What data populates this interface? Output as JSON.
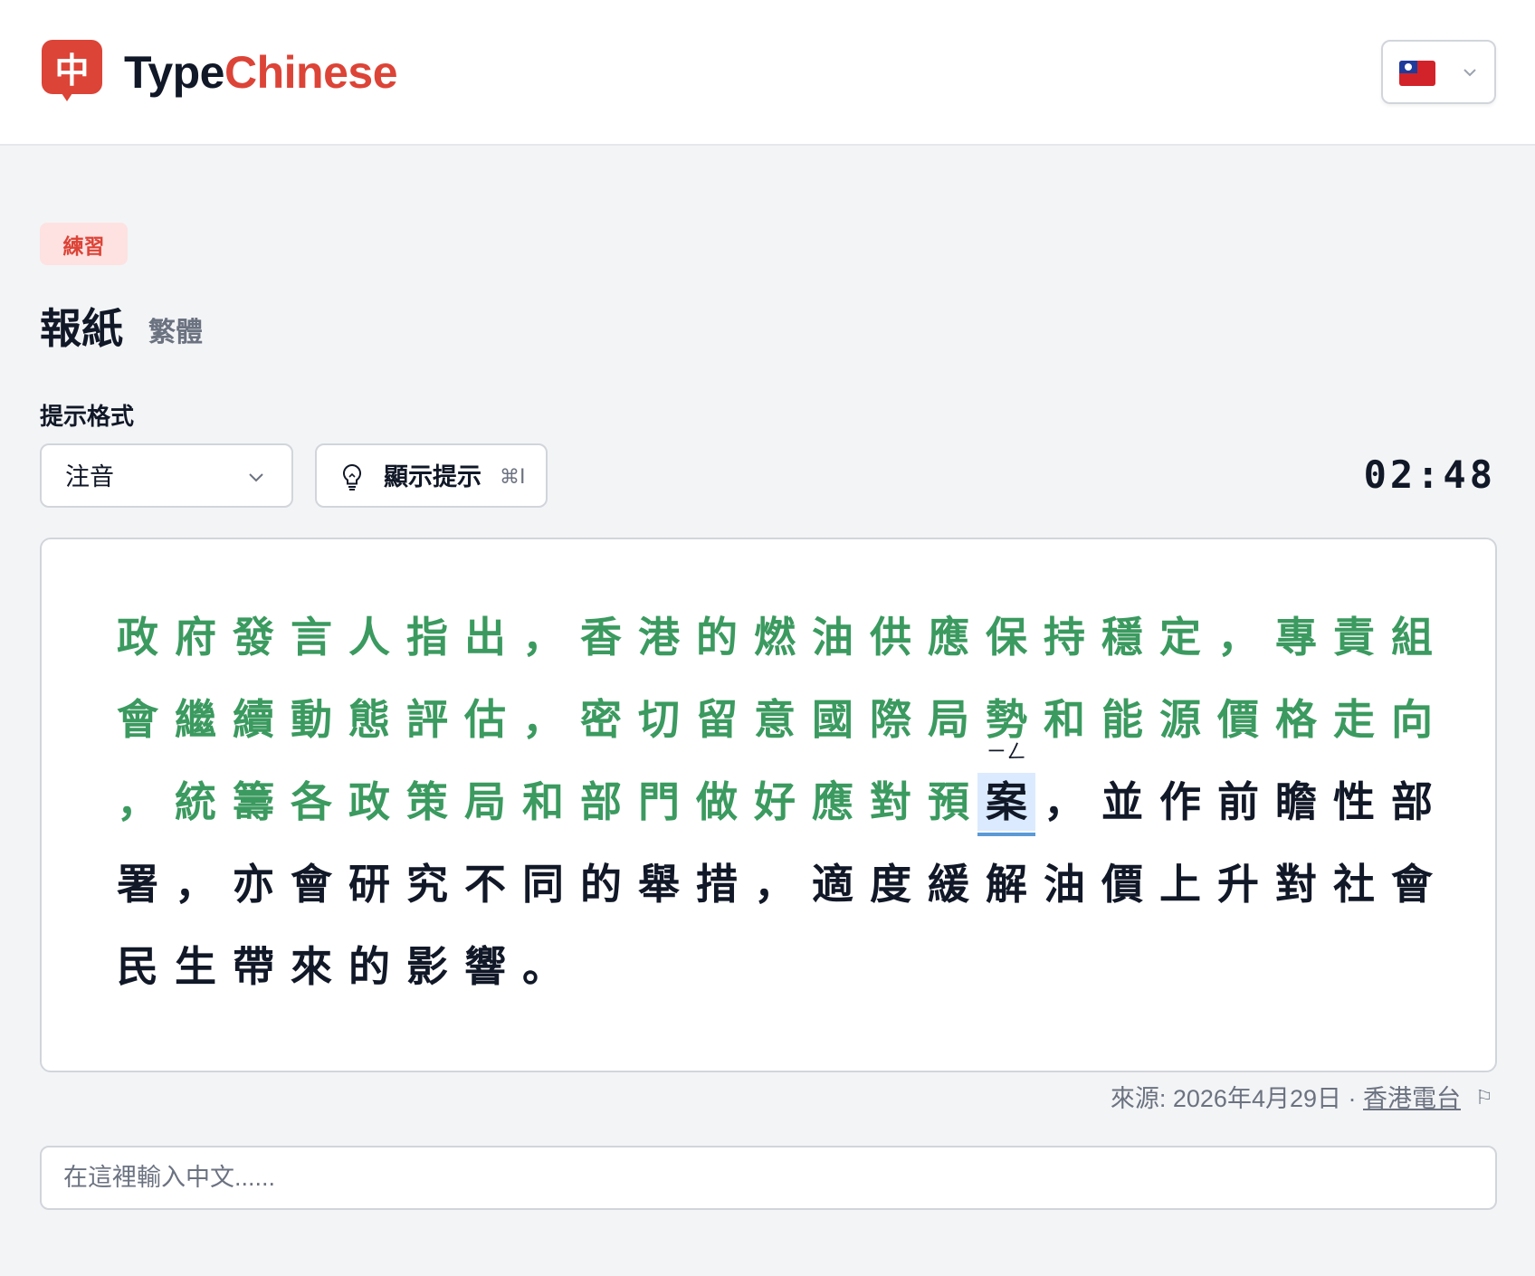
{
  "header": {
    "logo_char": "中",
    "brand_part1": "Type",
    "brand_part2": "Chinese",
    "language_flag": "taiwan-flag",
    "colors": {
      "brand": "#dc4437"
    }
  },
  "practice": {
    "tag": "練習",
    "title": "報紙",
    "script": "繁體",
    "hint_format_label": "提示格式",
    "hint_format_value": "注音",
    "show_hint_label": "顯示提示",
    "show_hint_shortcut": "⌘I",
    "timer": "02:48"
  },
  "passage": {
    "rows": [
      "政府發言人指出，香港的燃油供應保持穩定，專責組",
      "會繼續動態評估，密切留意國際局勢和能源價格走向",
      "，統籌各政策局和部門做好應對預案，並作前瞻性部",
      "署，亦會研究不同的舉措，適度緩解油價上升對社會",
      "民生帶來的影響。"
    ],
    "typed_count": 61,
    "current_zhuyin": "ㄧㄥ",
    "colors": {
      "typed": "#3b9a5f",
      "pending": "#111827",
      "current_bg": "#dbeafe"
    }
  },
  "source": {
    "prefix": "來源: 2026年4月29日 · ",
    "link": "香港電台"
  },
  "input": {
    "placeholder": "在這裡輸入中文......"
  }
}
